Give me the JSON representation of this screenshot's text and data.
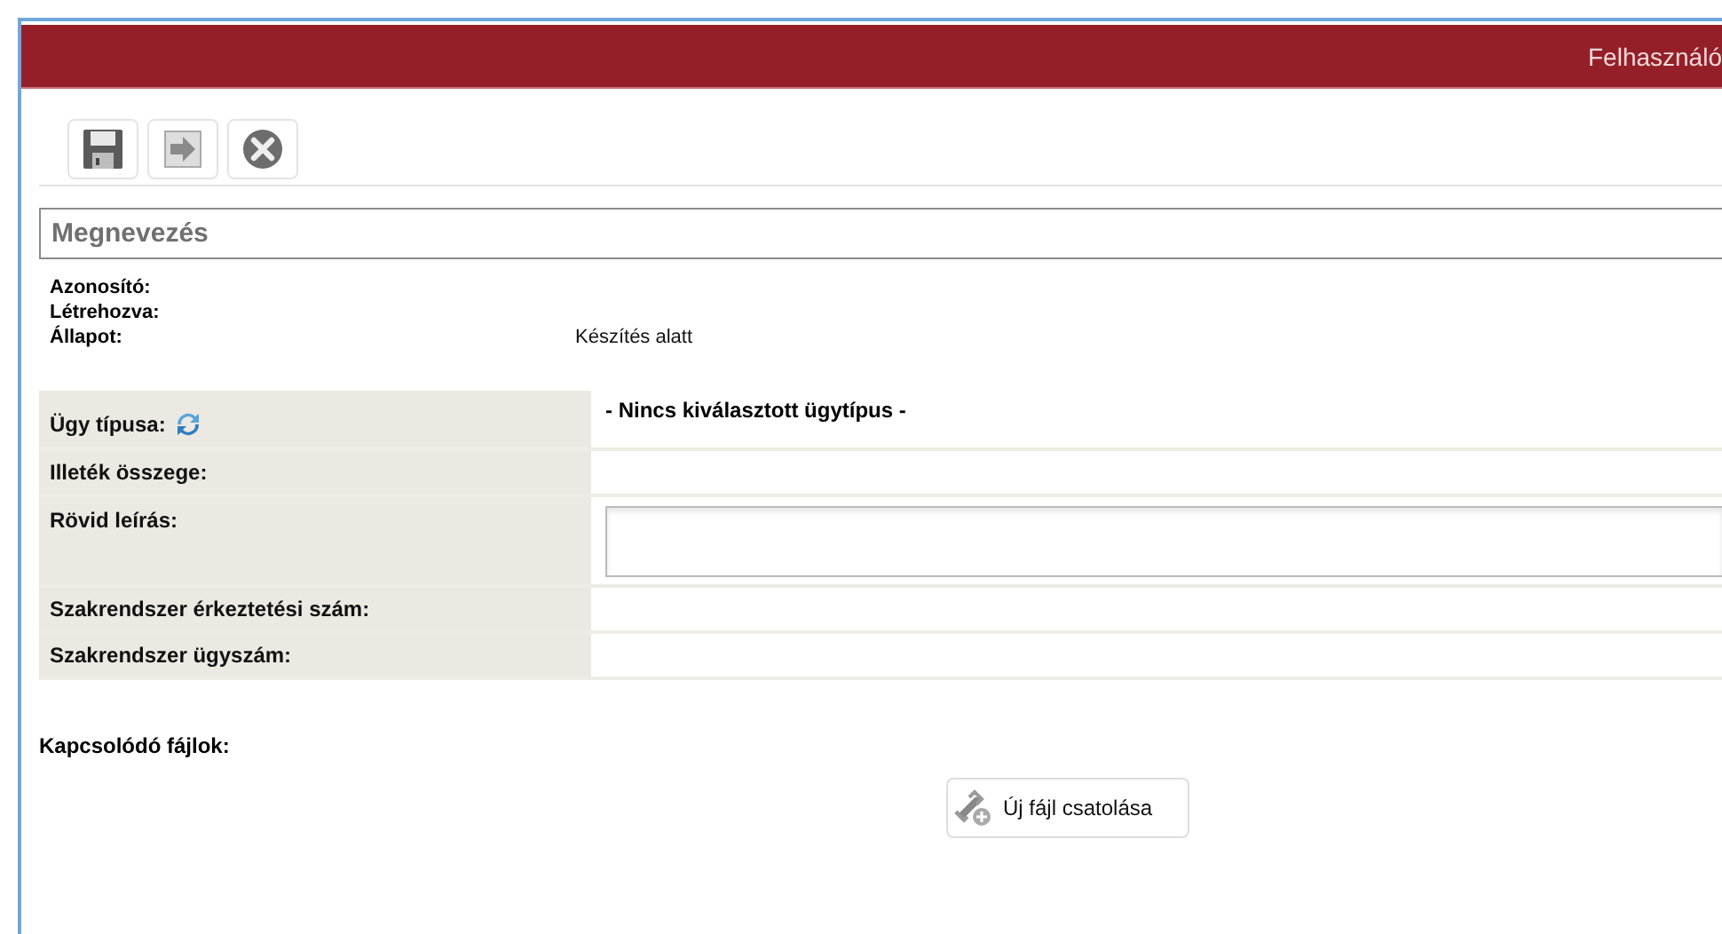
{
  "header": {
    "title": "Felhasználó"
  },
  "name_field": {
    "placeholder": "Megnevezés"
  },
  "info": [
    {
      "label": "Azonosító:"
    },
    {
      "label": "Létrehozva:"
    },
    {
      "label": "Állapot:",
      "value": "Készítés alatt"
    }
  ],
  "form_rows": [
    {
      "kind": "select",
      "label": "Ügy típusa:",
      "value": "- Nincs kiválasztott ügytípus -"
    },
    {
      "kind": "text",
      "label": "Illeték összege:"
    },
    {
      "kind": "textarea",
      "label": "Rövid leírás:"
    },
    {
      "kind": "text",
      "label": "Szakrendszer érkeztetési szám:"
    },
    {
      "kind": "text",
      "label": "Szakrendszer ügyszám:"
    }
  ],
  "attachments": {
    "label": "Kapcsolódó fájlok:",
    "button": "Új fájl csatolása"
  }
}
